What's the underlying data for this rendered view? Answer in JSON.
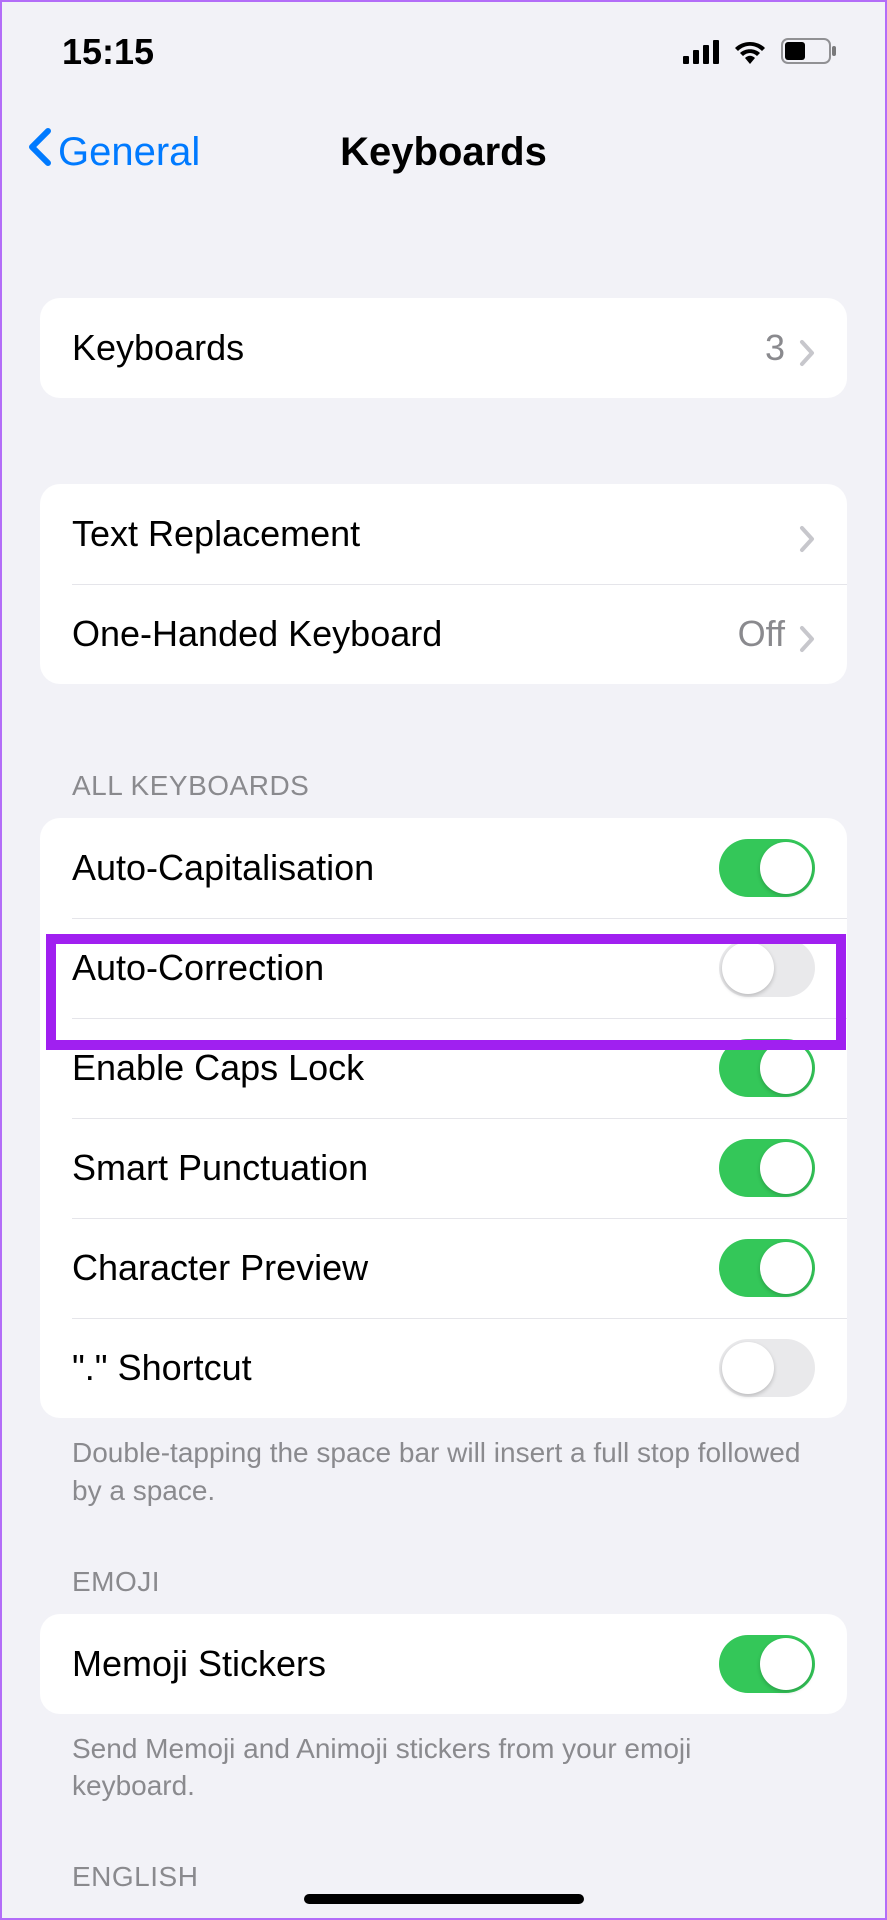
{
  "status": {
    "time": "15:15"
  },
  "nav": {
    "back": "General",
    "title": "Keyboards"
  },
  "group1": {
    "keyboards": {
      "label": "Keyboards",
      "value": "3"
    }
  },
  "group2": {
    "text_replacement": {
      "label": "Text Replacement"
    },
    "one_handed": {
      "label": "One-Handed Keyboard",
      "value": "Off"
    }
  },
  "all_kb": {
    "header": "ALL KEYBOARDS",
    "footer": "Double-tapping the space bar will insert a full stop followed by a space.",
    "items": [
      {
        "label": "Auto-Capitalisation",
        "on": true
      },
      {
        "label": "Auto-Correction",
        "on": false
      },
      {
        "label": "Enable Caps Lock",
        "on": true
      },
      {
        "label": "Smart Punctuation",
        "on": true
      },
      {
        "label": "Character Preview",
        "on": true
      },
      {
        "label": "\".\" Shortcut",
        "on": false
      }
    ]
  },
  "emoji": {
    "header": "EMOJI",
    "footer": "Send Memoji and Animoji stickers from your emoji keyboard.",
    "item": {
      "label": "Memoji Stickers",
      "on": true
    }
  },
  "english": {
    "header": "ENGLISH"
  }
}
